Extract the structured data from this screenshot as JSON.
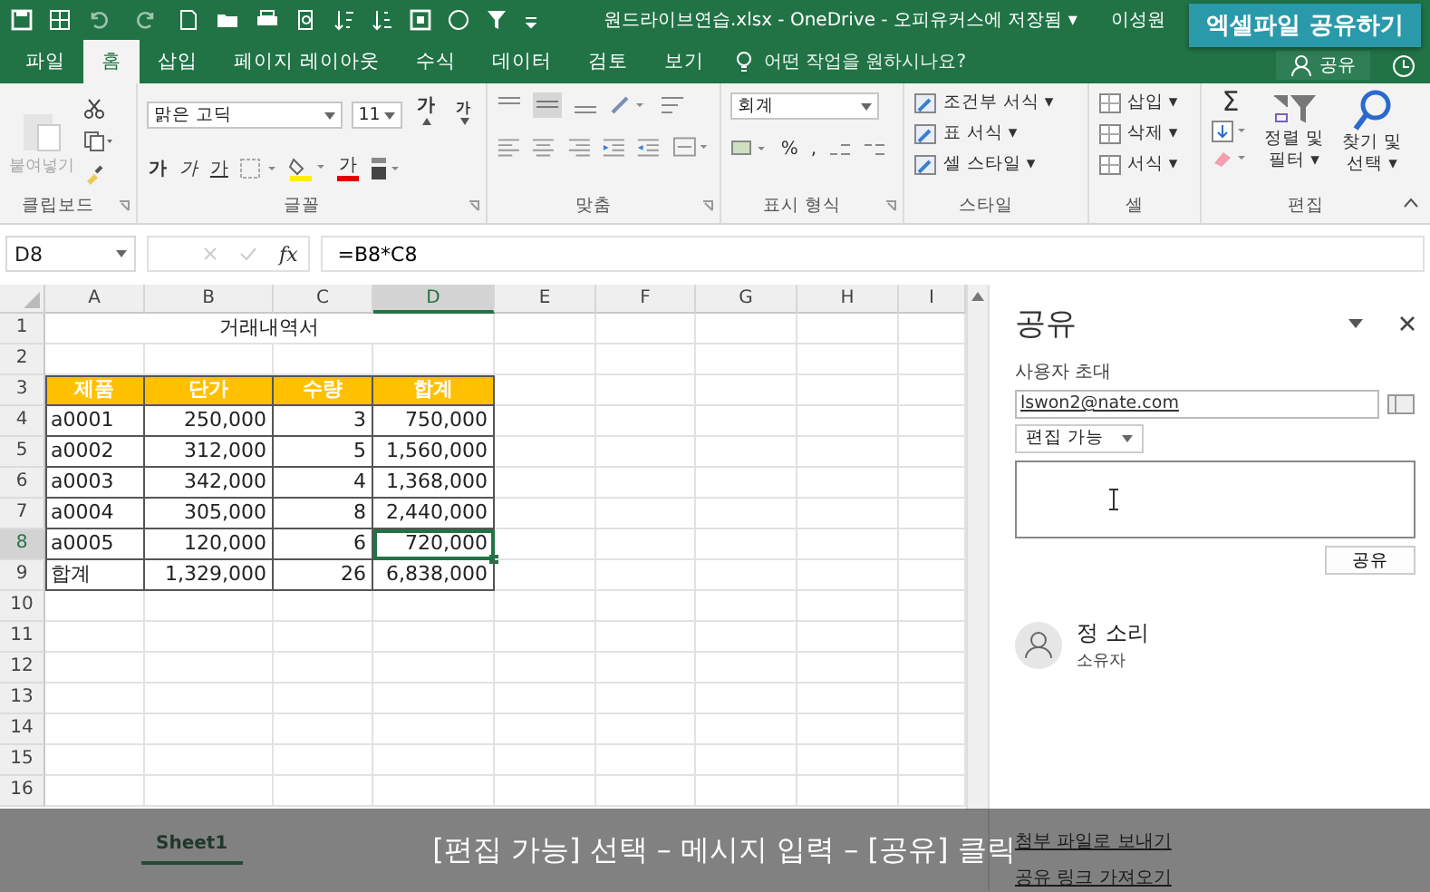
{
  "title_bar": {
    "title": "원드라이브연습.xlsx - OneDrive - 오피유커스에 저장됨 ▾",
    "user": "이성원"
  },
  "banner": "엑셀파일 공유하기",
  "tabs": [
    {
      "label": "파일",
      "selected": false
    },
    {
      "label": "홈",
      "selected": true
    },
    {
      "label": "삽입",
      "selected": false
    },
    {
      "label": "페이지 레이아웃",
      "selected": false
    },
    {
      "label": "수식",
      "selected": false
    },
    {
      "label": "데이터",
      "selected": false
    },
    {
      "label": "검토",
      "selected": false
    },
    {
      "label": "보기",
      "selected": false
    }
  ],
  "tell_me": {
    "placeholder": "어떤 작업을 원하시나요?"
  },
  "share_button": "공유",
  "ribbon": {
    "clipboard": {
      "label": "클립보드",
      "paste": "붙여넣기",
      "paste_disabled": true
    },
    "font": {
      "label": "글꼴",
      "family": "맑은 고딕",
      "size": "11",
      "grow": "가",
      "shrink": "가",
      "bold": "가",
      "italic": "가",
      "underline": "가",
      "font_color": "가"
    },
    "alignment": {
      "label": "맞춤"
    },
    "number": {
      "label": "표시 형식",
      "format": "회계",
      "percent": "%",
      "comma": ","
    },
    "styles": {
      "label": "스타일",
      "items": [
        "조건부 서식 ▾",
        "표 서식 ▾",
        "셀 스타일 ▾"
      ]
    },
    "cells": {
      "label": "셀",
      "items": [
        "삽입 ▾",
        "삭제 ▾",
        "서식 ▾"
      ]
    },
    "editing": {
      "label": "편집",
      "sum": "Σ",
      "sort": "정렬 및 필터 ▾",
      "find": "찾기 및 선택 ▾"
    }
  },
  "formula_bar": {
    "name_box": "D8",
    "fx": "fx",
    "formula": "=B8*C8"
  },
  "sheet": {
    "columns": [
      {
        "label": "A",
        "selected": false
      },
      {
        "label": "B",
        "selected": false
      },
      {
        "label": "C",
        "selected": false
      },
      {
        "label": "D",
        "selected": true
      },
      {
        "label": "E",
        "selected": false
      },
      {
        "label": "F",
        "selected": false
      },
      {
        "label": "G",
        "selected": false
      },
      {
        "label": "H",
        "selected": false
      },
      {
        "label": "I",
        "selected": false
      }
    ],
    "row_headers": [
      {
        "label": "1",
        "selected": false
      },
      {
        "label": "2",
        "selected": false
      },
      {
        "label": "3",
        "selected": false
      },
      {
        "label": "4",
        "selected": false
      },
      {
        "label": "5",
        "selected": false
      },
      {
        "label": "6",
        "selected": false
      },
      {
        "label": "7",
        "selected": false
      },
      {
        "label": "8",
        "selected": true
      },
      {
        "label": "9",
        "selected": false
      },
      {
        "label": "10",
        "selected": false
      },
      {
        "label": "11",
        "selected": false
      },
      {
        "label": "12",
        "selected": false
      },
      {
        "label": "13",
        "selected": false
      },
      {
        "label": "14",
        "selected": false
      },
      {
        "label": "15",
        "selected": false
      },
      {
        "label": "16",
        "selected": false
      }
    ],
    "title": "거래내역서",
    "table_header": [
      "제품",
      "단가",
      "수량",
      "합계"
    ],
    "table_rows": [
      {
        "cells": [
          {
            "text": "a0001",
            "selected": false
          },
          {
            "text": "250,000",
            "selected": false
          },
          {
            "text": "3",
            "selected": false
          },
          {
            "text": "750,000",
            "selected": false
          }
        ]
      },
      {
        "cells": [
          {
            "text": "a0002",
            "selected": false
          },
          {
            "text": "312,000",
            "selected": false
          },
          {
            "text": "5",
            "selected": false
          },
          {
            "text": "1,560,000",
            "selected": false
          }
        ]
      },
      {
        "cells": [
          {
            "text": "a0003",
            "selected": false
          },
          {
            "text": "342,000",
            "selected": false
          },
          {
            "text": "4",
            "selected": false
          },
          {
            "text": "1,368,000",
            "selected": false
          }
        ]
      },
      {
        "cells": [
          {
            "text": "a0004",
            "selected": false
          },
          {
            "text": "305,000",
            "selected": false
          },
          {
            "text": "8",
            "selected": false
          },
          {
            "text": "2,440,000",
            "selected": false
          }
        ]
      },
      {
        "cells": [
          {
            "text": "a0005",
            "selected": false
          },
          {
            "text": "120,000",
            "selected": false
          },
          {
            "text": "6",
            "selected": false
          },
          {
            "text": "720,000",
            "selected": true
          }
        ]
      },
      {
        "cells": [
          {
            "text": "합계",
            "selected": false
          },
          {
            "text": "1,329,000",
            "selected": false
          },
          {
            "text": "26",
            "selected": false
          },
          {
            "text": "6,838,000",
            "selected": false
          }
        ]
      }
    ],
    "sheet_tab": "Sheet1"
  },
  "share_pane": {
    "title": "공유",
    "invite_label": "사용자 초대",
    "invite_value": "lswon2@nate.com",
    "permission": "편집 가능",
    "share_button": "공유",
    "person": {
      "name": "정 소리",
      "role": "소유자"
    },
    "links": [
      "첨부 파일로 보내기",
      "공유 링크 가져오기"
    ]
  },
  "caption": "[편집 가능] 선택 – 메시지 입력 – [공유] 클릭"
}
